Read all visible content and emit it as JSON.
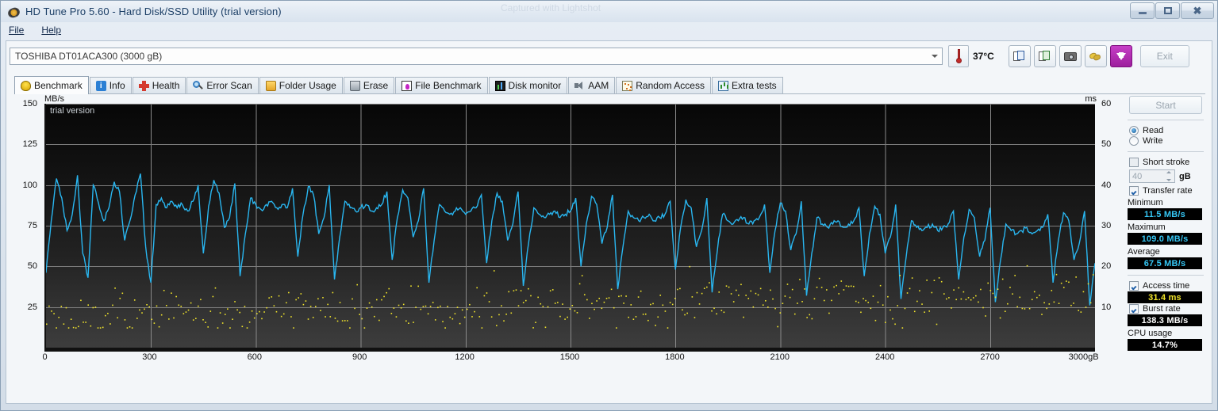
{
  "window": {
    "title": "HD Tune Pro 5.60 - Hard Disk/SSD Utility (trial version)",
    "watermark": "Captured with Lightshot",
    "icon": "disk-platter-icon",
    "controls": {
      "minimize": "minimize-icon",
      "maximize": "restore-icon",
      "close": "close-icon"
    }
  },
  "menu": {
    "items": [
      {
        "label": "File"
      },
      {
        "label": "Help"
      }
    ]
  },
  "toolbar": {
    "drive": "TOSHIBA DT01ACA300 (3000 gB)",
    "temperature": "37°C",
    "buttons": [
      {
        "name": "copy-text-button",
        "icon": "documents-icon"
      },
      {
        "name": "copy-image-button",
        "icon": "documents-image-icon"
      },
      {
        "name": "screenshot-button",
        "icon": "camera-icon"
      },
      {
        "name": "options-button",
        "icon": "gold-coins-icon"
      },
      {
        "name": "save-button",
        "icon": "download-arrow-icon"
      }
    ],
    "exit_label": "Exit"
  },
  "tabs": [
    {
      "label": "Benchmark",
      "icon": "bulb-icon",
      "active": true
    },
    {
      "label": "Info",
      "icon": "info-icon",
      "active": false
    },
    {
      "label": "Health",
      "icon": "red-cross-icon",
      "active": false
    },
    {
      "label": "Error Scan",
      "icon": "magnifier-icon",
      "active": false
    },
    {
      "label": "Folder Usage",
      "icon": "folder-icon",
      "active": false
    },
    {
      "label": "Erase",
      "icon": "trash-icon",
      "active": false
    },
    {
      "label": "File Benchmark",
      "icon": "file-icon",
      "active": false
    },
    {
      "label": "Disk monitor",
      "icon": "bar-chart-icon",
      "active": false
    },
    {
      "label": "AAM",
      "icon": "speaker-icon",
      "active": false
    },
    {
      "label": "Random Access",
      "icon": "scatter-icon",
      "active": false
    },
    {
      "label": "Extra tests",
      "icon": "extra-chart-icon",
      "active": false
    }
  ],
  "panel": {
    "start_label": "Start",
    "mode": {
      "read_label": "Read",
      "write_label": "Write",
      "selected": "Read"
    },
    "short_stroke": {
      "label": "Short stroke",
      "checked": false,
      "value": "40",
      "unit": "gB"
    },
    "transfer_rate": {
      "label": "Transfer rate",
      "checked": true
    },
    "minimum": {
      "label": "Minimum",
      "value": "11.5 MB/s",
      "color": "#35c6f4"
    },
    "maximum": {
      "label": "Maximum",
      "value": "109.0 MB/s",
      "color": "#35c6f4"
    },
    "average": {
      "label": "Average",
      "value": "67.5 MB/s",
      "color": "#35c6f4"
    },
    "access_time": {
      "label": "Access time",
      "checked": true,
      "value": "31.4 ms",
      "color": "#f2e52b"
    },
    "burst_rate": {
      "label": "Burst rate",
      "checked": true,
      "value": "138.3 MB/s",
      "color": "#ffffff"
    },
    "cpu_usage": {
      "label": "CPU usage",
      "value": "14.7%",
      "color": "#ffffff"
    }
  },
  "chart_data": {
    "type": "line",
    "title": "",
    "watermark": "trial version",
    "ylabel": "MB/s",
    "y2label": "ms",
    "xlabel": "gB",
    "xlim": [
      0,
      3000
    ],
    "ylim": [
      0,
      150
    ],
    "y2lim": [
      0,
      60
    ],
    "grid": true,
    "xticks": [
      0,
      300,
      600,
      900,
      1200,
      1500,
      1800,
      2100,
      2400,
      2700,
      3000
    ],
    "xticklabels": [
      "0",
      "300",
      "600",
      "900",
      "1200",
      "1500",
      "1800",
      "2100",
      "2400",
      "2700",
      "3000gB"
    ],
    "yticks": [
      25,
      50,
      75,
      100,
      125,
      150
    ],
    "yticklabels": [
      "25",
      "50",
      "75",
      "100",
      "125",
      "150"
    ],
    "y2ticks": [
      10,
      20,
      30,
      40,
      50,
      60
    ],
    "y2ticklabels": [
      "10",
      "20",
      "30",
      "40",
      "50",
      "60"
    ],
    "series": [
      {
        "name": "Transfer rate",
        "color": "#29b6f0",
        "axis": "left",
        "units": "MB/s",
        "note": "Sawtooth transfer-rate curve declining from ~109 MB/s near LBA 0 to ~50 MB/s at 3000 gB, with deep periodic drops to 12-45 MB/s",
        "x": [
          0,
          15,
          30,
          45,
          60,
          75,
          90,
          105,
          120,
          135,
          150,
          165,
          180,
          195,
          210,
          225,
          240,
          255,
          270,
          285,
          300,
          315,
          330,
          345,
          360,
          375,
          390,
          405,
          420,
          435,
          450,
          465,
          480,
          495,
          510,
          525,
          540,
          555,
          570,
          585,
          600,
          615,
          630,
          645,
          660,
          675,
          690,
          705,
          720,
          735,
          750,
          765,
          780,
          795,
          810,
          825,
          840,
          855,
          870,
          885,
          900,
          915,
          930,
          945,
          960,
          975,
          990,
          1005,
          1020,
          1035,
          1050,
          1065,
          1080,
          1095,
          1110,
          1125,
          1140,
          1155,
          1170,
          1185,
          1200,
          1215,
          1230,
          1245,
          1260,
          1275,
          1290,
          1305,
          1320,
          1335,
          1350,
          1365,
          1380,
          1395,
          1410,
          1425,
          1440,
          1455,
          1470,
          1485,
          1500,
          1515,
          1530,
          1545,
          1560,
          1575,
          1590,
          1605,
          1620,
          1635,
          1650,
          1665,
          1680,
          1695,
          1710,
          1725,
          1740,
          1755,
          1770,
          1785,
          1800,
          1815,
          1830,
          1845,
          1860,
          1875,
          1890,
          1905,
          1920,
          1935,
          1950,
          1965,
          1980,
          1995,
          2010,
          2025,
          2040,
          2055,
          2070,
          2085,
          2100,
          2115,
          2130,
          2145,
          2160,
          2175,
          2190,
          2205,
          2220,
          2235,
          2250,
          2265,
          2280,
          2295,
          2310,
          2325,
          2340,
          2355,
          2370,
          2385,
          2400,
          2415,
          2430,
          2445,
          2460,
          2475,
          2490,
          2505,
          2520,
          2535,
          2550,
          2565,
          2580,
          2595,
          2610,
          2625,
          2640,
          2655,
          2670,
          2685,
          2700,
          2715,
          2730,
          2745,
          2760,
          2775,
          2790,
          2805,
          2820,
          2835,
          2850,
          2865,
          2880,
          2895,
          2910,
          2925,
          2940,
          2955,
          2970,
          2985,
          3000
        ],
        "y": [
          46,
          78,
          104,
          92,
          72,
          82,
          106,
          58,
          43,
          100,
          89,
          78,
          86,
          102,
          96,
          66,
          78,
          94,
          107,
          62,
          40,
          88,
          92,
          86,
          90,
          86,
          88,
          84,
          90,
          100,
          58,
          87,
          103,
          95,
          74,
          80,
          101,
          44,
          70,
          92,
          88,
          85,
          88,
          90,
          86,
          88,
          86,
          98,
          56,
          82,
          99,
          94,
          70,
          80,
          100,
          42,
          68,
          90,
          86,
          84,
          86,
          88,
          84,
          86,
          88,
          96,
          54,
          80,
          97,
          92,
          68,
          78,
          98,
          40,
          66,
          88,
          84,
          82,
          84,
          86,
          82,
          84,
          86,
          94,
          52,
          78,
          95,
          90,
          66,
          76,
          96,
          38,
          64,
          86,
          82,
          80,
          82,
          84,
          80,
          82,
          84,
          92,
          50,
          76,
          93,
          88,
          64,
          74,
          94,
          36,
          62,
          84,
          80,
          78,
          80,
          82,
          78,
          80,
          82,
          90,
          48,
          74,
          91,
          86,
          62,
          72,
          92,
          34,
          60,
          82,
          78,
          76,
          78,
          80,
          76,
          78,
          80,
          88,
          46,
          72,
          89,
          84,
          60,
          70,
          90,
          32,
          58,
          80,
          76,
          74,
          76,
          78,
          74,
          76,
          78,
          86,
          44,
          70,
          87,
          82,
          58,
          68,
          88,
          30,
          56,
          78,
          74,
          72,
          74,
          76,
          72,
          74,
          76,
          84,
          42,
          68,
          85,
          80,
          56,
          66,
          86,
          28,
          54,
          76,
          72,
          70,
          72,
          74,
          70,
          72,
          74,
          82,
          40,
          66,
          83,
          78,
          54,
          64,
          84,
          26,
          52,
          74,
          70,
          68,
          70,
          72,
          68,
          62,
          60,
          58,
          56,
          54,
          52,
          50,
          52,
          50
        ]
      },
      {
        "name": "Access time",
        "color": "#f2e52b",
        "axis": "right",
        "units": "ms",
        "marker": "dots",
        "note": "Scattered yellow dots, mostly between 6 and 22 ms, average 31.4 ms reported",
        "mean": 31.4,
        "range": [
          5,
          24
        ]
      }
    ]
  }
}
